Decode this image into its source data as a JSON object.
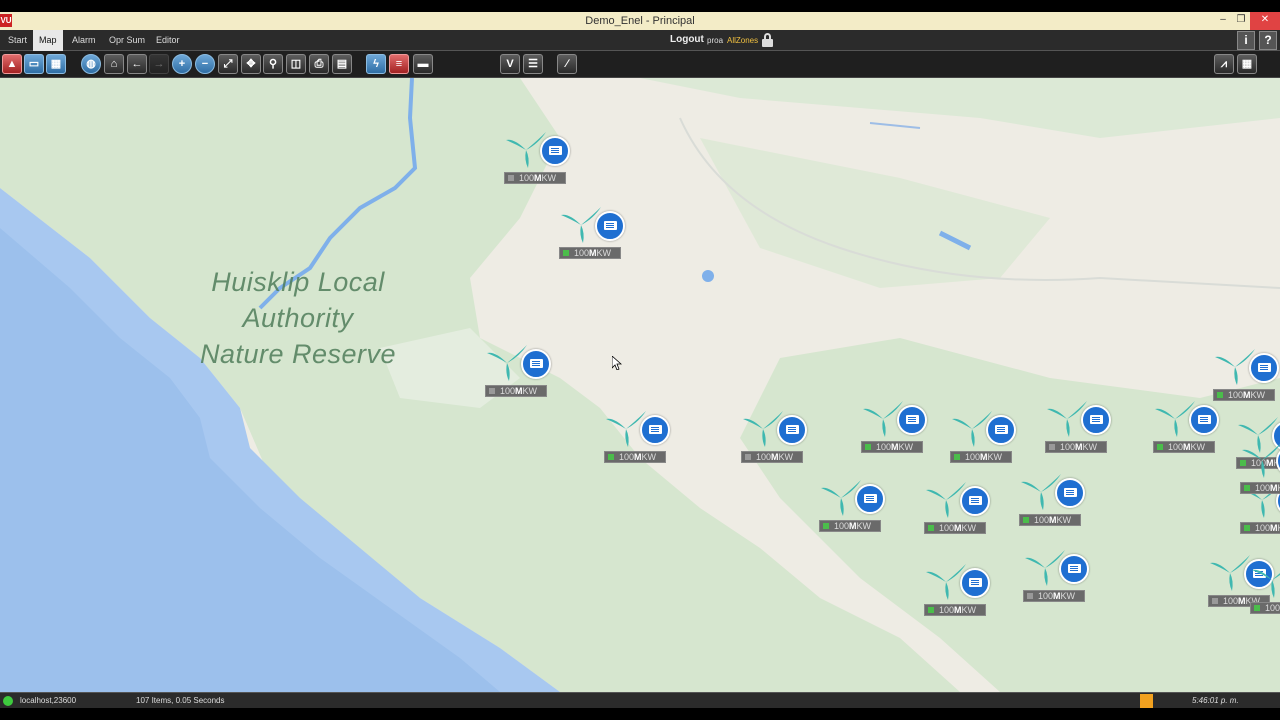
{
  "window": {
    "title": "Demo_Enel - Principal",
    "app_icon": "VU",
    "minimize": "–",
    "restore": "❐",
    "close": "✕"
  },
  "menu": {
    "items": [
      "Start",
      "Map",
      "Alarm",
      "Opr Sum",
      "Editor"
    ],
    "active": "Map",
    "logout": "Logout",
    "user": "proa",
    "zones": "AllZones",
    "info": "i",
    "help": "?"
  },
  "toolbar": {
    "icons": [
      "alarm-bell-icon",
      "window-icon",
      "grid-icon",
      "globe-icon",
      "home-icon",
      "back-arrow-icon",
      "forward-arrow-icon",
      "zoom-in-icon",
      "zoom-out-icon",
      "fit-icon",
      "pan-icon",
      "magnifier-icon",
      "layers-icon",
      "print-icon",
      "document-icon",
      "lightning-icon",
      "report-icon",
      "screen-icon",
      "vu-icon",
      "list-icon",
      "pen-icon",
      "trend-chart-icon",
      "table-icon"
    ]
  },
  "map": {
    "area_label": "Huisklip Local\nAuthority\nNature Reserve",
    "colors": {
      "sea": "#a8c8f0",
      "land": "#eeece4",
      "green": "#d3e5cc",
      "river": "#7fb0ea",
      "turbine": "#3fb8b0",
      "marker": "#1f6fd1"
    },
    "markers": [
      {
        "label_pre": "100",
        "label_bold": "M",
        "label_post": "KW",
        "status": "grey"
      },
      {
        "label_pre": "100",
        "label_bold": "M",
        "label_post": "KW",
        "status": "green"
      },
      {
        "label_pre": "100",
        "label_bold": "M",
        "label_post": "KW",
        "status": "grey"
      },
      {
        "label_pre": "100",
        "label_bold": "M",
        "label_post": "KW",
        "status": "green"
      },
      {
        "label_pre": "100",
        "label_bold": "M",
        "label_post": "KW",
        "status": "grey"
      },
      {
        "label_pre": "100",
        "label_bold": "M",
        "label_post": "KW",
        "status": "green"
      },
      {
        "label_pre": "100",
        "label_bold": "M",
        "label_post": "KW",
        "status": "green"
      },
      {
        "label_pre": "100",
        "label_bold": "M",
        "label_post": "KW",
        "status": "grey"
      },
      {
        "label_pre": "100",
        "label_bold": "M",
        "label_post": "KW",
        "status": "green"
      },
      {
        "label_pre": "100",
        "label_bold": "M",
        "label_post": "KW",
        "status": "green"
      },
      {
        "label_pre": "100",
        "label_bold": "M",
        "label_post": "KW",
        "status": "green"
      },
      {
        "label_pre": "100",
        "label_bold": "M",
        "label_post": "KW",
        "status": "green"
      },
      {
        "label_pre": "100",
        "label_bold": "M",
        "label_post": "KW",
        "status": "green"
      },
      {
        "label_pre": "100",
        "label_bold": "M",
        "label_post": "KW",
        "status": "green"
      },
      {
        "label_pre": "100",
        "label_bold": "M",
        "label_post": "KW",
        "status": "grey"
      },
      {
        "label_pre": "100",
        "label_bold": "M",
        "label_post": "KW",
        "status": "grey"
      },
      {
        "label_pre": "100",
        "label_bold": "M",
        "label_post": "KW",
        "status": "green"
      },
      {
        "label_pre": "100",
        "label_bold": "M",
        "label_post": "KW",
        "status": "green"
      },
      {
        "label_pre": "100",
        "label_bold": "M",
        "label_post": "KW",
        "status": "green"
      },
      {
        "label_pre": "100",
        "label_bold": "M",
        "label_post": "KW",
        "status": "green"
      }
    ]
  },
  "status": {
    "server": "localhost,23600",
    "items": "107 Items, 0.05 Seconds",
    "time": "5:46:01 p. m."
  }
}
